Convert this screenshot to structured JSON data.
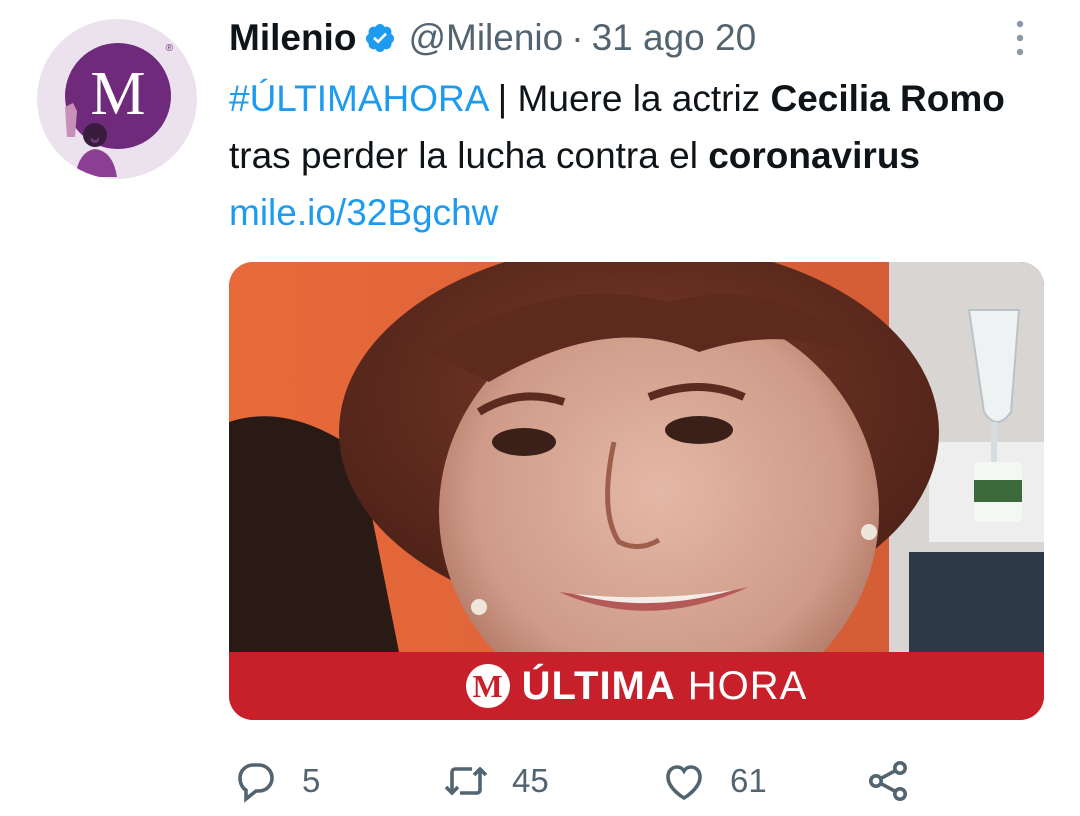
{
  "tweet": {
    "display_name": "Milenio",
    "handle": "@Milenio",
    "separator": "·",
    "date": "31 ago 20",
    "text": {
      "hashtag": "#ÚLTIMAHORA",
      "part1": " | Muere la actriz ",
      "bold1": "Cecilia Romo",
      "part2": " tras perder la lucha contra el ",
      "bold2": "coronavirus",
      "space": " ",
      "link": "mile.io/32Bgchw"
    },
    "avatar": {
      "letter": "M",
      "reg_mark": "®"
    },
    "media": {
      "banner_logo": "M",
      "banner_strong": "ÚLTIMA",
      "banner_light": "HORA"
    },
    "stats": {
      "replies": "5",
      "retweets": "45",
      "likes": "61"
    }
  },
  "colors": {
    "brand_purple": "#6f2a7b",
    "link_blue": "#1d9bf0",
    "verified_blue": "#1d9bf0",
    "banner_red": "#c8202b",
    "muted_gray": "#536471"
  },
  "icons": {
    "verified": "verified-badge-icon",
    "more": "more-options-icon",
    "reply": "reply-icon",
    "retweet": "retweet-icon",
    "like": "heart-icon",
    "share": "share-icon"
  }
}
